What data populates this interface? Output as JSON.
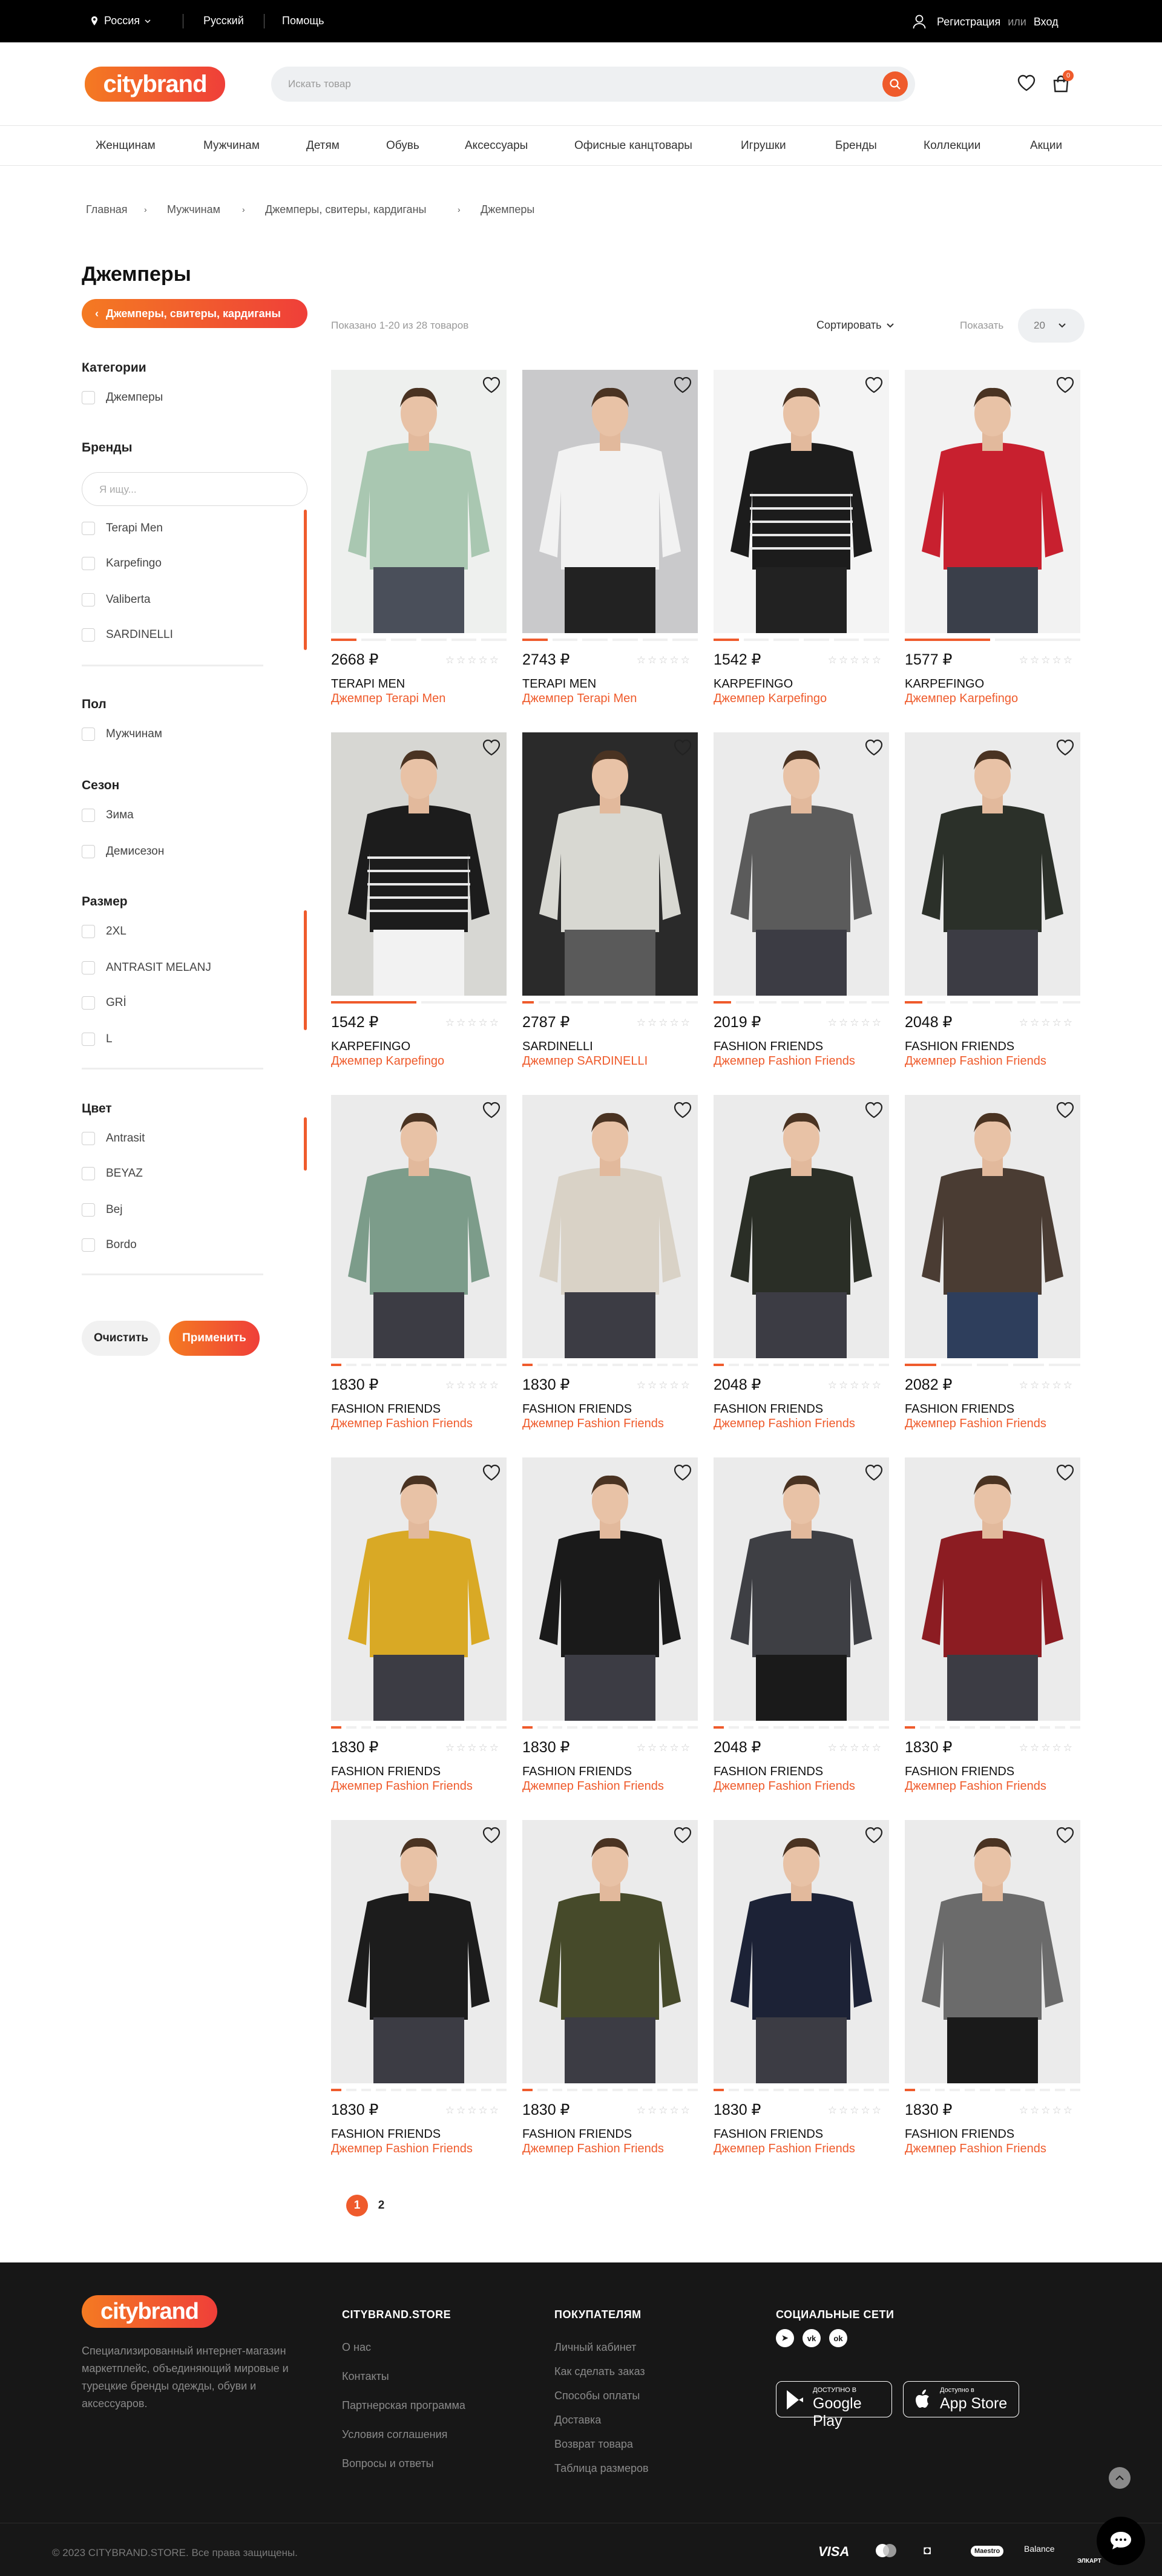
{
  "topbar": {
    "region": "Россия",
    "language": "Русский",
    "help": "Помощь",
    "register": "Регистрация",
    "or": "или",
    "login": "Вход"
  },
  "header": {
    "logo": "citybrand",
    "search_placeholder": "Искать товар",
    "cart_count": "0"
  },
  "nav": [
    "Женщинам",
    "Мужчинам",
    "Детям",
    "Обувь",
    "Аксессуары",
    "Офисные канцтовары",
    "Игрушки",
    "Бренды",
    "Коллекции",
    "Акции"
  ],
  "breadcrumb": [
    "Главная",
    "Мужчинам",
    "Джемперы, свитеры, кардиганы",
    "Джемперы"
  ],
  "page_title": "Джемперы",
  "parent_category": "Джемперы, свитеры, кардиганы",
  "filters": {
    "categories": {
      "title": "Категории",
      "options": [
        "Джемперы"
      ]
    },
    "brands": {
      "title": "Бренды",
      "search_placeholder": "Я ищу...",
      "options": [
        "Terapi Men",
        "Karpefingo",
        "Valiberta",
        "SARDINELLI"
      ]
    },
    "gender": {
      "title": "Пол",
      "options": [
        "Мужчинам"
      ]
    },
    "season": {
      "title": "Сезон",
      "options": [
        "Зима",
        "Демисезон"
      ]
    },
    "size": {
      "title": "Размер",
      "options": [
        "2XL",
        "ANTRASIT MELANJ",
        "GRİ",
        "L"
      ]
    },
    "color": {
      "title": "Цвет",
      "options": [
        "Antrasit",
        "BEYAZ",
        "Bej",
        "Bordo"
      ]
    },
    "clear": "Очистить",
    "apply": "Применить"
  },
  "toolbar": {
    "shown": "Показано 1-20 из 28 товаров",
    "sort": "Сортировать",
    "show_label": "Показать",
    "show_value": "20"
  },
  "products": [
    {
      "price": "2668 ₽",
      "brand": "TERAPI MEN",
      "name": "Джемпер Terapi Men",
      "sweater": "#a9c7b1",
      "bg": "#eef0ee",
      "pants": "#4a4f5a",
      "active_photo": 0,
      "photos": 6
    },
    {
      "price": "2743 ₽",
      "brand": "TERAPI MEN",
      "name": "Джемпер Terapi Men",
      "sweater": "#f2f2f2",
      "bg": "#c9c9cb",
      "pants": "#222",
      "active_photo": 0,
      "photos": 6
    },
    {
      "price": "1542 ₽",
      "brand": "KARPEFINGO",
      "name": "Джемпер Karpefingo",
      "sweater": "#1c1c1c",
      "bg": "#f4f4f4",
      "pants": "#222",
      "active_photo": 0,
      "photos": 6,
      "stripes": true
    },
    {
      "price": "1577 ₽",
      "brand": "KARPEFINGO",
      "name": "Джемпер Karpefingo",
      "sweater": "#c8202f",
      "bg": "#f2f2f2",
      "pants": "#3a3f4a",
      "active_photo": 0,
      "photos": 2
    },
    {
      "price": "1542 ₽",
      "brand": "KARPEFINGO",
      "name": "Джемпер Karpefingo",
      "sweater": "#1c1c1c",
      "bg": "#d7d7d3",
      "pants": "#f2f2f2",
      "active_photo": 0,
      "photos": 2,
      "stripes": true
    },
    {
      "price": "2787 ₽",
      "brand": "SARDINELLI",
      "name": "Джемпер SARDINELLI",
      "sweater": "#d8d8d2",
      "bg": "#2a2a2a",
      "pants": "#5a5a5a",
      "active_photo": 0,
      "photos": 11
    },
    {
      "price": "2019 ₽",
      "brand": "FASHION FRIENDS",
      "name": "Джемпер Fashion Friends",
      "sweater": "#5b5b5b",
      "bg": "#ebebeb",
      "pants": "#3c3c44",
      "active_photo": 0,
      "photos": 8
    },
    {
      "price": "2048 ₽",
      "brand": "FASHION FRIENDS",
      "name": "Джемпер Fashion Friends",
      "sweater": "#2b3029",
      "bg": "#ebebeb",
      "pants": "#3c3c44",
      "active_photo": 0,
      "photos": 8
    },
    {
      "price": "1830 ₽",
      "brand": "FASHION FRIENDS",
      "name": "Джемпер Fashion Friends",
      "sweater": "#7c9c8a",
      "bg": "#ebebeb",
      "pants": "#3c3c44",
      "active_photo": 0,
      "photos": 12
    },
    {
      "price": "1830 ₽",
      "brand": "FASHION FRIENDS",
      "name": "Джемпер Fashion Friends",
      "sweater": "#d9d2c6",
      "bg": "#ebebeb",
      "pants": "#3c3c44",
      "active_photo": 0,
      "photos": 12
    },
    {
      "price": "2048 ₽",
      "brand": "FASHION FRIENDS",
      "name": "Джемпер Fashion Friends",
      "sweater": "#2a2e26",
      "bg": "#ebebeb",
      "pants": "#3c3c44",
      "active_photo": 0,
      "photos": 12
    },
    {
      "price": "2082 ₽",
      "brand": "FASHION FRIENDS",
      "name": "Джемпер Fashion Friends",
      "sweater": "#4a3c33",
      "bg": "#ebebeb",
      "pants": "#2e3e5c",
      "active_photo": 0,
      "photos": 5
    },
    {
      "price": "1830 ₽",
      "brand": "FASHION FRIENDS",
      "name": "Джемпер Fashion Friends",
      "sweater": "#d9a925",
      "bg": "#ebebeb",
      "pants": "#3c3c44",
      "active_photo": 0,
      "photos": 12
    },
    {
      "price": "1830 ₽",
      "brand": "FASHION FRIENDS",
      "name": "Джемпер Fashion Friends",
      "sweater": "#1a1a1a",
      "bg": "#ebebeb",
      "pants": "#3c3c44",
      "active_photo": 0,
      "photos": 12
    },
    {
      "price": "2048 ₽",
      "brand": "FASHION FRIENDS",
      "name": "Джемпер Fashion Friends",
      "sweater": "#3e3f44",
      "bg": "#ebebeb",
      "pants": "#1a1a1a",
      "active_photo": 0,
      "photos": 12
    },
    {
      "price": "1830 ₽",
      "brand": "FASHION FRIENDS",
      "name": "Джемпер Fashion Friends",
      "sweater": "#8c1c22",
      "bg": "#ebebeb",
      "pants": "#3c3c44",
      "active_photo": 0,
      "photos": 12
    },
    {
      "price": "1830 ₽",
      "brand": "FASHION FRIENDS",
      "name": "Джемпер Fashion Friends",
      "sweater": "#1c1c1c",
      "bg": "#ebebeb",
      "pants": "#3c3c44",
      "active_photo": 0,
      "photos": 12
    },
    {
      "price": "1830 ₽",
      "brand": "FASHION FRIENDS",
      "name": "Джемпер Fashion Friends",
      "sweater": "#464a2a",
      "bg": "#ebebeb",
      "pants": "#3c3c44",
      "active_photo": 0,
      "photos": 12
    },
    {
      "price": "1830 ₽",
      "brand": "FASHION FRIENDS",
      "name": "Джемпер Fashion Friends",
      "sweater": "#1c2236",
      "bg": "#ebebeb",
      "pants": "#3c3c44",
      "active_photo": 0,
      "photos": 12
    },
    {
      "price": "1830 ₽",
      "brand": "FASHION FRIENDS",
      "name": "Джемпер Fashion Friends",
      "sweater": "#6b6b6b",
      "bg": "#ebebeb",
      "pants": "#1a1a1a",
      "active_photo": 0,
      "photos": 12
    }
  ],
  "pagination": {
    "pages": [
      "1",
      "2"
    ],
    "current": "1"
  },
  "footer": {
    "logo": "citybrand",
    "about": "Специализированный интернет-магазин маркетплейс, объединяющий мировые и турецкие бренды одежды, обуви и аксессуаров.",
    "col1": {
      "title": "CITYBRAND.STORE",
      "links": [
        "О нас",
        "Контакты",
        "Партнерская программа",
        "Условия соглашения",
        "Вопросы и ответы"
      ]
    },
    "col2": {
      "title": "ПОКУПАТЕЛЯМ",
      "links": [
        "Личный кабинет",
        "Как сделать заказ",
        "Способы оплаты",
        "Доставка",
        "Возврат товара",
        "Таблица размеров"
      ]
    },
    "social": {
      "title": "СОЦИАЛЬНЫЕ СЕТИ",
      "items": [
        "telegram-icon",
        "vk-icon",
        "odnoklassniki-icon"
      ]
    },
    "google": {
      "small": "ДОСТУПНО В",
      "big": "Google Play"
    },
    "apple": {
      "small": "Доступно в",
      "big": "App Store"
    },
    "copyright": "© 2023 CITYBRAND.STORE. Все права защищены.",
    "payments": [
      "VISA",
      "Mastercard",
      "QIWI",
      "Maestro",
      "Balance",
      "ЭЛКАРТ"
    ]
  },
  "colors": {
    "accent": "#ef5b2c",
    "accent2": "#f47a22",
    "footer": "#171717"
  }
}
